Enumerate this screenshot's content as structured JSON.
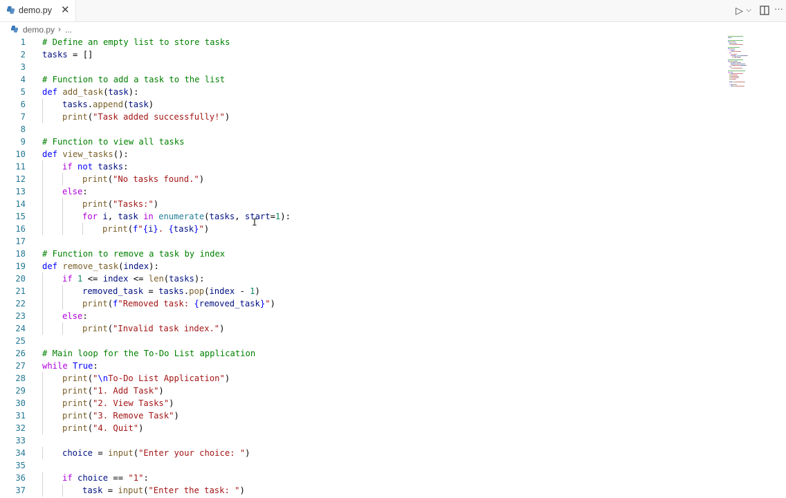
{
  "tab": {
    "label": "demo.py",
    "close": "✕",
    "icon": "python-file-icon"
  },
  "actions": {
    "run": "▷",
    "run_menu": "⌵",
    "split": "split-editor-icon",
    "more": "···"
  },
  "breadcrumb": {
    "file": "demo.py",
    "separator": "›",
    "more": "..."
  },
  "colors": {
    "comment": "#008000",
    "keyword": "#0000ff",
    "control": "#af00db",
    "function": "#795e26",
    "string": "#a31515",
    "number": "#098658",
    "variable": "#001080",
    "builtin": "#267f99",
    "line_number": "#237893"
  },
  "code_lines": [
    {
      "n": "1",
      "indent": 0,
      "tokens": [
        [
          "comment",
          "# Define an empty list to store tasks"
        ]
      ]
    },
    {
      "n": "2",
      "indent": 0,
      "tokens": [
        [
          "variable",
          "tasks"
        ],
        [
          "plain",
          " = []"
        ]
      ]
    },
    {
      "n": "3",
      "indent": 0,
      "tokens": []
    },
    {
      "n": "4",
      "indent": 0,
      "tokens": [
        [
          "comment",
          "# Function to add a task to the list"
        ]
      ]
    },
    {
      "n": "5",
      "indent": 0,
      "tokens": [
        [
          "keyword",
          "def"
        ],
        [
          "plain",
          " "
        ],
        [
          "function",
          "add_task"
        ],
        [
          "plain",
          "("
        ],
        [
          "variable",
          "task"
        ],
        [
          "plain",
          "):"
        ]
      ]
    },
    {
      "n": "6",
      "indent": 1,
      "tokens": [
        [
          "variable",
          "tasks"
        ],
        [
          "plain",
          "."
        ],
        [
          "function",
          "append"
        ],
        [
          "plain",
          "("
        ],
        [
          "variable",
          "task"
        ],
        [
          "plain",
          ")"
        ]
      ]
    },
    {
      "n": "7",
      "indent": 1,
      "tokens": [
        [
          "function",
          "print"
        ],
        [
          "plain",
          "("
        ],
        [
          "string",
          "\"Task added successfully!\""
        ],
        [
          "plain",
          ")"
        ]
      ]
    },
    {
      "n": "8",
      "indent": 0,
      "tokens": []
    },
    {
      "n": "9",
      "indent": 0,
      "tokens": [
        [
          "comment",
          "# Function to view all tasks"
        ]
      ]
    },
    {
      "n": "10",
      "indent": 0,
      "tokens": [
        [
          "keyword",
          "def"
        ],
        [
          "plain",
          " "
        ],
        [
          "function",
          "view_tasks"
        ],
        [
          "plain",
          "():"
        ]
      ]
    },
    {
      "n": "11",
      "indent": 1,
      "tokens": [
        [
          "control",
          "if"
        ],
        [
          "plain",
          " "
        ],
        [
          "keyword",
          "not"
        ],
        [
          "plain",
          " "
        ],
        [
          "variable",
          "tasks"
        ],
        [
          "plain",
          ":"
        ]
      ]
    },
    {
      "n": "12",
      "indent": 2,
      "tokens": [
        [
          "function",
          "print"
        ],
        [
          "plain",
          "("
        ],
        [
          "string",
          "\"No tasks found.\""
        ],
        [
          "plain",
          ")"
        ]
      ]
    },
    {
      "n": "13",
      "indent": 1,
      "tokens": [
        [
          "control",
          "else"
        ],
        [
          "plain",
          ":"
        ]
      ]
    },
    {
      "n": "14",
      "indent": 2,
      "tokens": [
        [
          "function",
          "print"
        ],
        [
          "plain",
          "("
        ],
        [
          "string",
          "\"Tasks:\""
        ],
        [
          "plain",
          ")"
        ]
      ]
    },
    {
      "n": "15",
      "indent": 2,
      "tokens": [
        [
          "control",
          "for"
        ],
        [
          "plain",
          " "
        ],
        [
          "variable",
          "i"
        ],
        [
          "plain",
          ", "
        ],
        [
          "variable",
          "task"
        ],
        [
          "plain",
          " "
        ],
        [
          "control",
          "in"
        ],
        [
          "plain",
          " "
        ],
        [
          "builtin",
          "enumerate"
        ],
        [
          "plain",
          "("
        ],
        [
          "variable",
          "tasks"
        ],
        [
          "plain",
          ", "
        ],
        [
          "variable",
          "start"
        ],
        [
          "plain",
          "="
        ],
        [
          "number",
          "1"
        ],
        [
          "plain",
          "):"
        ]
      ]
    },
    {
      "n": "16",
      "indent": 3,
      "tokens": [
        [
          "function",
          "print"
        ],
        [
          "plain",
          "("
        ],
        [
          "keyword",
          "f"
        ],
        [
          "string",
          "\""
        ],
        [
          "brace",
          "{"
        ],
        [
          "variable",
          "i"
        ],
        [
          "brace",
          "}"
        ],
        [
          "string",
          ". "
        ],
        [
          "brace",
          "{"
        ],
        [
          "variable",
          "task"
        ],
        [
          "brace",
          "}"
        ],
        [
          "string",
          "\""
        ],
        [
          "plain",
          ")"
        ]
      ]
    },
    {
      "n": "17",
      "indent": 0,
      "tokens": []
    },
    {
      "n": "18",
      "indent": 0,
      "tokens": [
        [
          "comment",
          "# Function to remove a task by index"
        ]
      ]
    },
    {
      "n": "19",
      "indent": 0,
      "tokens": [
        [
          "keyword",
          "def"
        ],
        [
          "plain",
          " "
        ],
        [
          "function",
          "remove_task"
        ],
        [
          "plain",
          "("
        ],
        [
          "variable",
          "index"
        ],
        [
          "plain",
          "):"
        ]
      ]
    },
    {
      "n": "20",
      "indent": 1,
      "tokens": [
        [
          "control",
          "if"
        ],
        [
          "plain",
          " "
        ],
        [
          "number",
          "1"
        ],
        [
          "plain",
          " <= "
        ],
        [
          "variable",
          "index"
        ],
        [
          "plain",
          " <= "
        ],
        [
          "function",
          "len"
        ],
        [
          "plain",
          "("
        ],
        [
          "variable",
          "tasks"
        ],
        [
          "plain",
          "):"
        ]
      ]
    },
    {
      "n": "21",
      "indent": 2,
      "tokens": [
        [
          "variable",
          "removed_task"
        ],
        [
          "plain",
          " = "
        ],
        [
          "variable",
          "tasks"
        ],
        [
          "plain",
          "."
        ],
        [
          "function",
          "pop"
        ],
        [
          "plain",
          "("
        ],
        [
          "variable",
          "index"
        ],
        [
          "plain",
          " - "
        ],
        [
          "number",
          "1"
        ],
        [
          "plain",
          ")"
        ]
      ]
    },
    {
      "n": "22",
      "indent": 2,
      "tokens": [
        [
          "function",
          "print"
        ],
        [
          "plain",
          "("
        ],
        [
          "keyword",
          "f"
        ],
        [
          "string",
          "\"Removed task: "
        ],
        [
          "brace",
          "{"
        ],
        [
          "variable",
          "removed_task"
        ],
        [
          "brace",
          "}"
        ],
        [
          "string",
          "\""
        ],
        [
          "plain",
          ")"
        ]
      ]
    },
    {
      "n": "23",
      "indent": 1,
      "tokens": [
        [
          "control",
          "else"
        ],
        [
          "plain",
          ":"
        ]
      ]
    },
    {
      "n": "24",
      "indent": 2,
      "tokens": [
        [
          "function",
          "print"
        ],
        [
          "plain",
          "("
        ],
        [
          "string",
          "\"Invalid task index.\""
        ],
        [
          "plain",
          ")"
        ]
      ]
    },
    {
      "n": "25",
      "indent": 0,
      "tokens": []
    },
    {
      "n": "26",
      "indent": 0,
      "tokens": [
        [
          "comment",
          "# Main loop for the To-Do List application"
        ]
      ]
    },
    {
      "n": "27",
      "indent": 0,
      "tokens": [
        [
          "control",
          "while"
        ],
        [
          "plain",
          " "
        ],
        [
          "keyword",
          "True"
        ],
        [
          "plain",
          ":"
        ]
      ]
    },
    {
      "n": "28",
      "indent": 1,
      "tokens": [
        [
          "function",
          "print"
        ],
        [
          "plain",
          "("
        ],
        [
          "string",
          "\""
        ],
        [
          "keyword",
          "\\n"
        ],
        [
          "string",
          "To-Do List Application\""
        ],
        [
          "plain",
          ")"
        ]
      ]
    },
    {
      "n": "29",
      "indent": 1,
      "tokens": [
        [
          "function",
          "print"
        ],
        [
          "plain",
          "("
        ],
        [
          "string",
          "\"1. Add Task\""
        ],
        [
          "plain",
          ")"
        ]
      ]
    },
    {
      "n": "30",
      "indent": 1,
      "tokens": [
        [
          "function",
          "print"
        ],
        [
          "plain",
          "("
        ],
        [
          "string",
          "\"2. View Tasks\""
        ],
        [
          "plain",
          ")"
        ]
      ]
    },
    {
      "n": "31",
      "indent": 1,
      "tokens": [
        [
          "function",
          "print"
        ],
        [
          "plain",
          "("
        ],
        [
          "string",
          "\"3. Remove Task\""
        ],
        [
          "plain",
          ")"
        ]
      ]
    },
    {
      "n": "32",
      "indent": 1,
      "tokens": [
        [
          "function",
          "print"
        ],
        [
          "plain",
          "("
        ],
        [
          "string",
          "\"4. Quit\""
        ],
        [
          "plain",
          ")"
        ]
      ]
    },
    {
      "n": "33",
      "indent": 0,
      "tokens": []
    },
    {
      "n": "34",
      "indent": 1,
      "tokens": [
        [
          "variable",
          "choice"
        ],
        [
          "plain",
          " = "
        ],
        [
          "function",
          "input"
        ],
        [
          "plain",
          "("
        ],
        [
          "string",
          "\"Enter your choice: \""
        ],
        [
          "plain",
          ")"
        ]
      ]
    },
    {
      "n": "35",
      "indent": 0,
      "tokens": []
    },
    {
      "n": "36",
      "indent": 1,
      "tokens": [
        [
          "control",
          "if"
        ],
        [
          "plain",
          " "
        ],
        [
          "variable",
          "choice"
        ],
        [
          "plain",
          " == "
        ],
        [
          "string",
          "\"1\""
        ],
        [
          "plain",
          ":"
        ]
      ]
    },
    {
      "n": "37",
      "indent": 2,
      "tokens": [
        [
          "variable",
          "task"
        ],
        [
          "plain",
          " = "
        ],
        [
          "function",
          "input"
        ],
        [
          "plain",
          "("
        ],
        [
          "string",
          "\"Enter the task: \""
        ],
        [
          "plain",
          ")"
        ]
      ]
    }
  ]
}
